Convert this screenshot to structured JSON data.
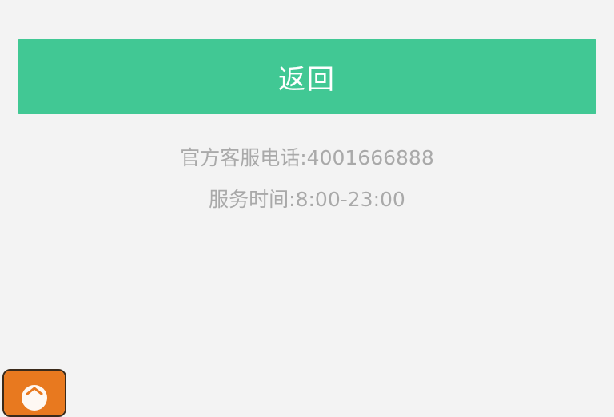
{
  "back_button": {
    "label": "返回"
  },
  "contact": {
    "hotline": "官方客服电话:4001666888",
    "hours": "服务时间:8:00-23:00"
  },
  "floating_app": {
    "icon": "orange-app-icon"
  },
  "colors": {
    "accent": "#41c894",
    "background": "#f3f3f3",
    "secondary_text": "#a9a9a9",
    "floating_icon": "#e8791f"
  }
}
